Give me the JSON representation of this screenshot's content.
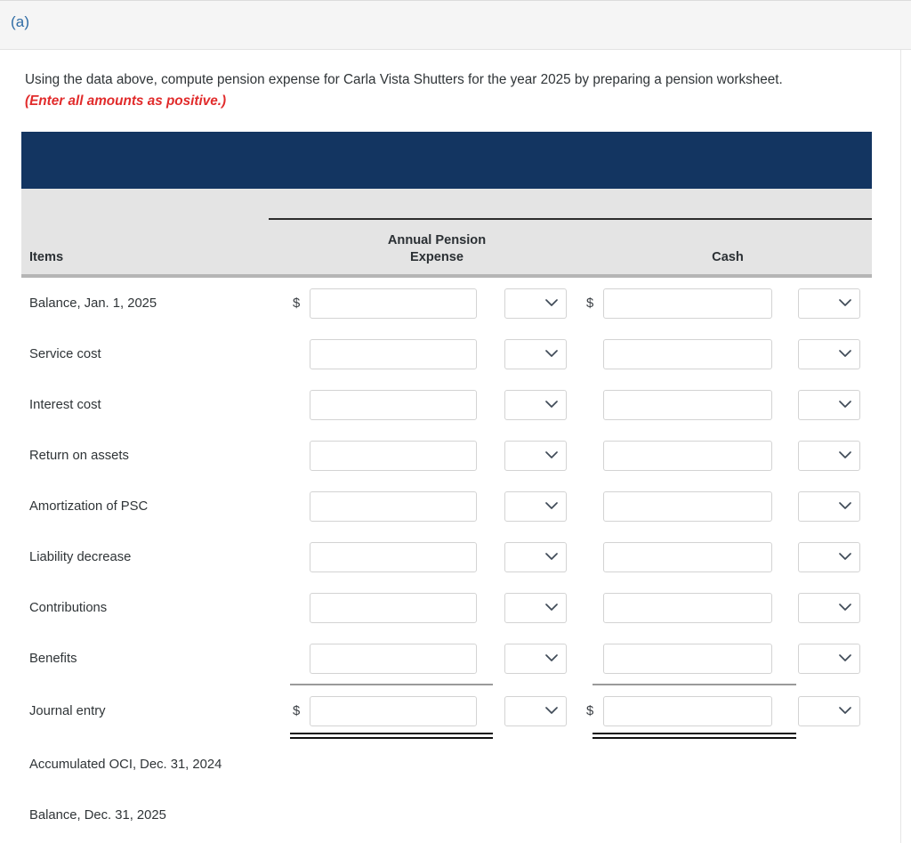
{
  "header": {
    "part_label": "(a)"
  },
  "prompt": {
    "text": "Using the data above, compute pension expense for Carla Vista Shutters for the year 2025 by preparing a pension worksheet.",
    "note": "(Enter all amounts as positive.)"
  },
  "worksheet": {
    "columns": {
      "items": "Items",
      "expense_line1": "Annual Pension",
      "expense_line2": "Expense",
      "cash": "Cash"
    },
    "currency_symbol": "$",
    "rows": [
      {
        "label": "Balance, Jan. 1, 2025",
        "expense_dollar": true,
        "expense_input": "",
        "expense_select": "",
        "cash_dollar": true,
        "cash_input": "",
        "cash_select": ""
      },
      {
        "label": "Service cost",
        "expense_dollar": false,
        "expense_input": "",
        "expense_select": "",
        "cash_dollar": false,
        "cash_input": "",
        "cash_select": ""
      },
      {
        "label": "Interest cost",
        "expense_dollar": false,
        "expense_input": "",
        "expense_select": "",
        "cash_dollar": false,
        "cash_input": "",
        "cash_select": ""
      },
      {
        "label": "Return on assets",
        "expense_dollar": false,
        "expense_input": "",
        "expense_select": "",
        "cash_dollar": false,
        "cash_input": "",
        "cash_select": ""
      },
      {
        "label": "Amortization of PSC",
        "expense_dollar": false,
        "expense_input": "",
        "expense_select": "",
        "cash_dollar": false,
        "cash_input": "",
        "cash_select": ""
      },
      {
        "label": "Liability decrease",
        "expense_dollar": false,
        "expense_input": "",
        "expense_select": "",
        "cash_dollar": false,
        "cash_input": "",
        "cash_select": ""
      },
      {
        "label": "Contributions",
        "expense_dollar": false,
        "expense_input": "",
        "expense_select": "",
        "cash_dollar": false,
        "cash_input": "",
        "cash_select": ""
      },
      {
        "label": "Benefits",
        "expense_dollar": false,
        "expense_input": "",
        "expense_select": "",
        "cash_dollar": false,
        "cash_input": "",
        "cash_select": ""
      },
      {
        "label": "Journal entry",
        "expense_dollar": true,
        "expense_input": "",
        "expense_select": "",
        "cash_dollar": true,
        "cash_input": "",
        "cash_select": "",
        "rule_above": true,
        "rule_below": true
      },
      {
        "label": "Accumulated OCI, Dec. 31, 2024",
        "no_inputs": true
      },
      {
        "label": "Balance, Dec. 31, 2025",
        "no_inputs": true
      }
    ]
  },
  "colors": {
    "band": "#133561",
    "header_bg": "#e4e4e4",
    "part_label": "#2f6ca5",
    "note": "#e12b2b"
  }
}
